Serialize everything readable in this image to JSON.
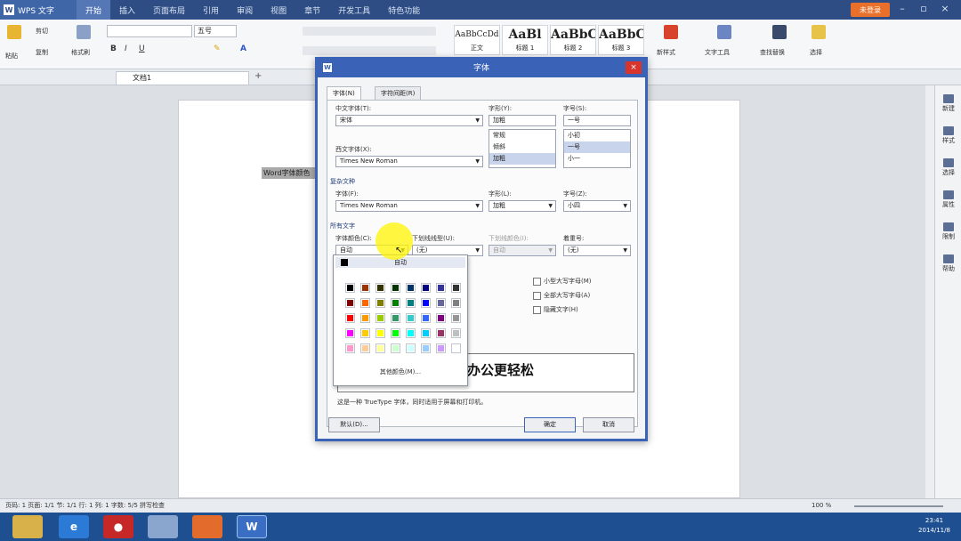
{
  "app": {
    "name": "WPS 文字",
    "signin": "未登录"
  },
  "menus": [
    "开始",
    "插入",
    "页面布局",
    "引用",
    "审阅",
    "视图",
    "章节",
    "开发工具",
    "特色功能"
  ],
  "ribbon": {
    "font_size": "五号",
    "styles": [
      {
        "sample": "AaBbCcDd",
        "caption": "正文"
      },
      {
        "sample": "AaBl",
        "caption": "标题 1"
      },
      {
        "sample": "AaBbC",
        "caption": "标题 2"
      },
      {
        "sample": "AaBbC",
        "caption": "标题 3"
      }
    ],
    "new_style": "新样式",
    "text_tools": "文字工具",
    "find_replace": "查找替换",
    "select": "选择",
    "paste": "粘贴",
    "cut": "剪切",
    "copy": "复制",
    "format_painter": "格式刷"
  },
  "doc_tab": "文档1",
  "doc": {
    "selected_text": "Word字体颜色"
  },
  "right_sidebar": [
    "新建",
    "样式",
    "选择",
    "属性",
    "限制",
    "帮助"
  ],
  "status": {
    "left": "页码: 1  页面: 1/1  节: 1/1  行: 1  列: 1  字数: 5/5  拼写检查",
    "zoom": "100 %"
  },
  "clock": {
    "time": "23:41",
    "date": "2014/11/8"
  },
  "dialog": {
    "title": "字体",
    "close": "×",
    "tabs": [
      "字体(N)",
      "字符间距(R)"
    ],
    "cn_font_label": "中文字体(T):",
    "cn_font": "宋体",
    "style_label": "字形(Y):",
    "style_value": "加粗",
    "style_options": [
      "常规",
      "倾斜",
      "加粗"
    ],
    "size_label": "字号(S):",
    "size_value": "一号",
    "size_options": [
      "小初",
      "一号",
      "小一"
    ],
    "west_font_label": "西文字体(X):",
    "west_font": "Times New Roman",
    "complex_section": "复杂文种",
    "complex_font_label": "字体(F):",
    "complex_font": "Times New Roman",
    "complex_style_label": "字形(L):",
    "complex_style": "加粗",
    "complex_size_label": "字号(Z):",
    "complex_size": "小四",
    "all_text_section": "所有文字",
    "color_label": "字体颜色(C):",
    "color_value": "自动",
    "underline_label": "下划线线型(U):",
    "underline_value": "(无)",
    "underline_color_label": "下划线颜色(I):",
    "underline_color_value": "自动",
    "emphasis_label": "着重号:",
    "emphasis_value": "(无)",
    "effects": [
      "小型大写字母(M)",
      "全部大写字母(A)",
      "隐藏文字(H)"
    ],
    "preview_text": "办公更轻松",
    "note": "这是一种 TrueType 字体，同时适用于屏幕和打印机。",
    "default_button": "默认(D)...",
    "ok": "确定",
    "cancel": "取消"
  },
  "color_popup": {
    "auto_label": "自动",
    "more_colors": "其他颜色(M)...",
    "rows": [
      [
        "#000000",
        "#993300",
        "#333300",
        "#003300",
        "#003366",
        "#000080",
        "#333399",
        "#333333"
      ],
      [
        "#800000",
        "#ff6600",
        "#808000",
        "#008000",
        "#008080",
        "#0000ff",
        "#666699",
        "#808080"
      ],
      [
        "#ff0000",
        "#ff9900",
        "#99cc00",
        "#339966",
        "#33cccc",
        "#3366ff",
        "#800080",
        "#969696"
      ],
      [
        "#ff00ff",
        "#ffcc00",
        "#ffff00",
        "#00ff00",
        "#00ffff",
        "#00ccff",
        "#993366",
        "#c0c0c0"
      ],
      [
        "#ff99cc",
        "#ffcc99",
        "#ffff99",
        "#ccffcc",
        "#ccffff",
        "#99ccff",
        "#cc99ff",
        "#ffffff"
      ]
    ]
  }
}
